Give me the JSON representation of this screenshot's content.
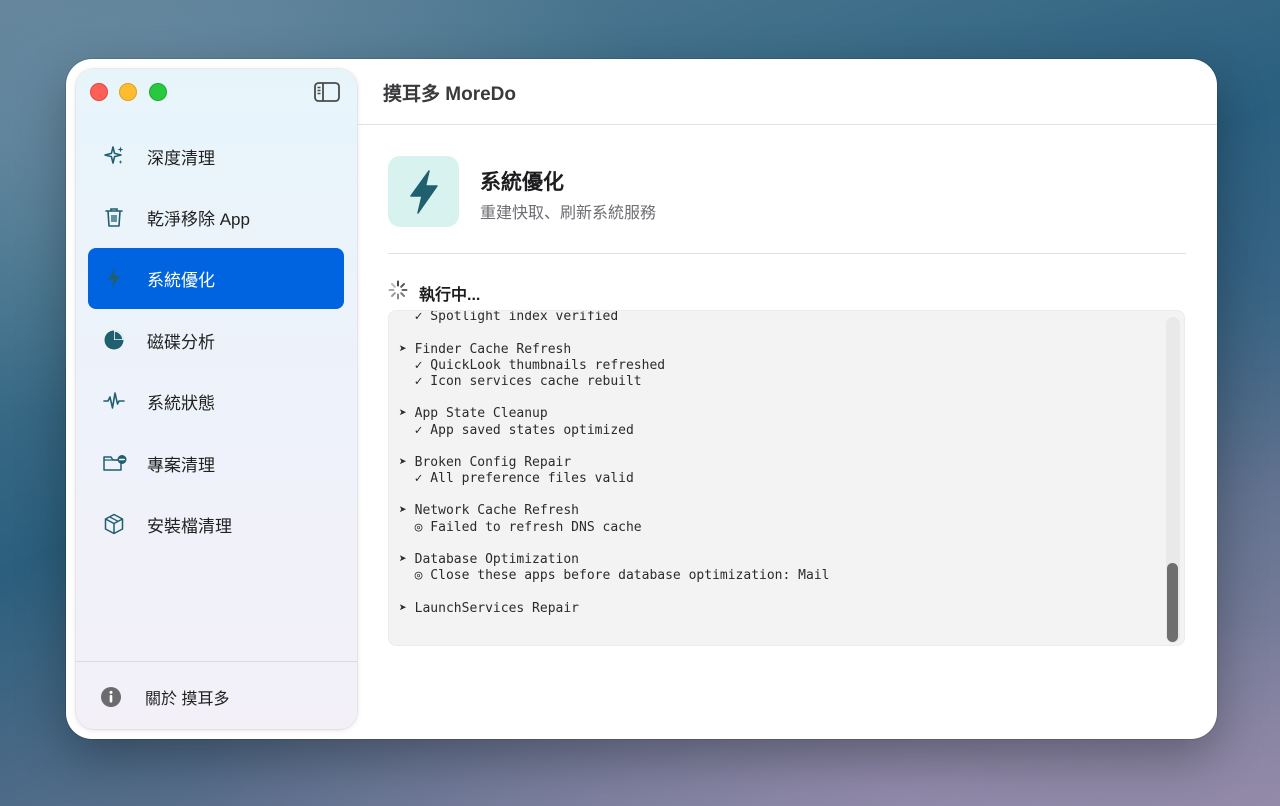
{
  "app": {
    "title": "摸耳多 MoreDo"
  },
  "sidebar": {
    "items": [
      {
        "label": "深度清理",
        "icon": "sparkles-icon"
      },
      {
        "label": "乾淨移除 App",
        "icon": "trash-icon"
      },
      {
        "label": "系統優化",
        "icon": "bolt-icon",
        "active": true
      },
      {
        "label": "磁碟分析",
        "icon": "pie-chart-icon"
      },
      {
        "label": "系統狀態",
        "icon": "waveform-icon"
      },
      {
        "label": "專案清理",
        "icon": "folder-minus-icon"
      },
      {
        "label": "安裝檔清理",
        "icon": "package-icon"
      }
    ],
    "about_label": "關於 摸耳多"
  },
  "feature": {
    "title": "系統優化",
    "subtitle": "重建快取、刷新系統服務",
    "accent": "#1f5f6e",
    "tile_bg": "#d8f3ef"
  },
  "status": {
    "text": "執行中..."
  },
  "log": {
    "lines": [
      "  ✓ Spotlight index verified",
      "",
      "➤ Finder Cache Refresh",
      "  ✓ QuickLook thumbnails refreshed",
      "  ✓ Icon services cache rebuilt",
      "",
      "➤ App State Cleanup",
      "  ✓ App saved states optimized",
      "",
      "➤ Broken Config Repair",
      "  ✓ All preference files valid",
      "",
      "➤ Network Cache Refresh",
      "  ◎ Failed to refresh DNS cache",
      "",
      "➤ Database Optimization",
      "  ◎ Close these apps before database optimization: Mail",
      "",
      "➤ LaunchServices Repair"
    ]
  },
  "colors": {
    "selection": "#0064e0",
    "icon_teal": "#1f5f6e"
  }
}
